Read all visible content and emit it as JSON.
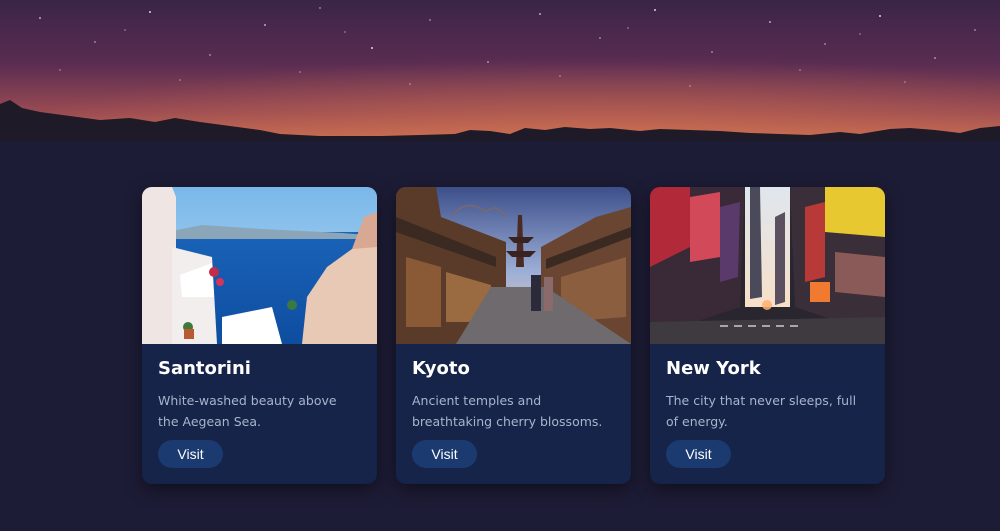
{
  "destinations": [
    {
      "title": "Santorini",
      "description": "White-washed beauty above the Aegean Sea.",
      "button_label": "Visit"
    },
    {
      "title": "Kyoto",
      "description": "Ancient temples and breathtaking cherry blossoms.",
      "button_label": "Visit"
    },
    {
      "title": "New York",
      "description": "The city that never sleeps, full of energy.",
      "button_label": "Visit"
    }
  ],
  "colors": {
    "page_background": "#1d1c36",
    "card_background": "#162449",
    "button_background": "#1b3a70"
  }
}
